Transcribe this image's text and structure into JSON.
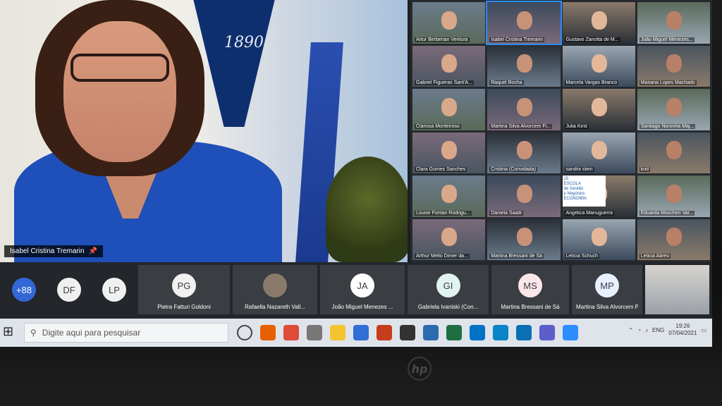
{
  "speaker": {
    "name": "Isabel Cristina Tremarin",
    "banner_year": "1890"
  },
  "gallery": [
    {
      "label": "Artur Berberian Ventura"
    },
    {
      "label": "Isabel Cristina Tremarin",
      "active": true
    },
    {
      "label": "Gustavo Zanotta de M..."
    },
    {
      "label": "João Miguel Menezes..."
    },
    {
      "label": "Gabriel Figueras Sant'A..."
    },
    {
      "label": "Raquel Rocha"
    },
    {
      "label": "Marcela Vargas Branco"
    },
    {
      "label": "Mariana Lopes Machado"
    },
    {
      "label": "Clarissa Monteiroso"
    },
    {
      "label": "Martina Silva Alvorcem Fi..."
    },
    {
      "label": "Julia Kirst"
    },
    {
      "label": "Santiago Noronha Maj..."
    },
    {
      "label": "Clara Gomes Sanches"
    },
    {
      "label": "Cristina (Convidada)"
    },
    {
      "label": "sandra stein"
    },
    {
      "label": "krid"
    },
    {
      "label": "Louise Fontan Rodrigu..."
    },
    {
      "label": "Daniela Saadi"
    },
    {
      "label": "Angelica Manuguerra"
    },
    {
      "label": "Eduarda Moschen Var..."
    },
    {
      "label": "Arthur Mello Dimer da..."
    },
    {
      "label": "Martina Bressani de Sá"
    },
    {
      "label": "Leticia Schuch"
    },
    {
      "label": "Leticia Abreu"
    }
  ],
  "gallery_slide": {
    "line1": "ESCOLA",
    "line2": "de Gestão",
    "line3": "e Negócios",
    "number": "15",
    "word": "ECONOMIA"
  },
  "strip": [
    {
      "initials": "+88",
      "name": "",
      "more": true
    },
    {
      "initials": "DF",
      "name": ""
    },
    {
      "initials": "LP",
      "name": ""
    },
    {
      "initials": "PG",
      "name": "Pietra Fatturi Goldoni"
    },
    {
      "initials": "",
      "name": "Rafaella Nazareth Vall..."
    },
    {
      "initials": "JA",
      "name": "João Miguel Menezes ..."
    },
    {
      "initials": "GI",
      "name": "Gabriela Ivaniski (Con..."
    },
    {
      "initials": "MS",
      "name": "Martina Bressani de Sá"
    },
    {
      "initials": "MP",
      "name": "Martina Silva Alvorcem Pin..."
    }
  ],
  "taskbar": {
    "search_placeholder": "Digite aqui para pesquisar",
    "language": "ENG",
    "time": "19:26",
    "date": "07/04/2021"
  },
  "laptop_brand": "hp"
}
